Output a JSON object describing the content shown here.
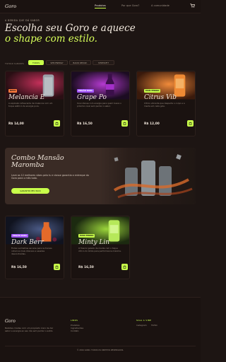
{
  "header": {
    "logo": "Goro",
    "nav": [
      "Produtos",
      "Por que Goro?",
      "A comunidade"
    ],
    "cart_icon": "cart-icon"
  },
  "hero": {
    "eyebrow": "A BEBIDA QUE DÁ SABOR",
    "title_line1": "Escolha seu Goro e aquece",
    "title_line2": "o shape com estilo."
  },
  "filters": {
    "label": "FILTRAR SABORES",
    "chips": [
      "TODOS",
      "SEM ENERGY",
      "BAIXO REDUZ.",
      "STRESSFIT"
    ],
    "active_index": 0
  },
  "products_row1": [
    {
      "tag": "NOVO",
      "title": "Melancia E",
      "desc": "A explosão refrescante de melancia com um toque elétrico de energia pura.",
      "price": "R$ 14,00"
    },
    {
      "tag": "EDIÇÃO RARA",
      "title": "Grape Po",
      "desc": "Uva intensa com energia para quem busca o próximo nível sem perder o sabor.",
      "price": "R$ 16,50"
    },
    {
      "tag": "MAIS PEDIDO",
      "title": "Citrus Vib",
      "desc": "Cítrico vibrante que desperta o corpo e a mente em cada gole.",
      "price": "R$ 12,00"
    }
  ],
  "combo": {
    "title_line1": "Combo Mansão",
    "title_line2": "Maromba",
    "desc": "Leve as 12 melhores vibes pelo tu e classe garantia a entreque do Goro para o mês todo.",
    "button": "GARANTIR MEU PACK"
  },
  "products_row2": [
    {
      "tag": "EDIÇÃO RARA",
      "title": "Dark Berr",
      "desc": "Frutas vermelhas escuras para os treinos noturnos mais intensos e sessões descontraídas.",
      "price": "R$ 16,50"
    },
    {
      "tag": "MAIS PEDIDO",
      "title": "Minty Lin",
      "desc": "O frescor gelado da menta com o toque cítrico do limão para performance máxima.",
      "price": "R$ 16,50"
    }
  ],
  "footer": {
    "logo": "Goro",
    "about": "Bebidas criadas com um propósito claro de dar sabor e energia ao seu dia sem perder o estilo.",
    "col1_title": "LINKS",
    "col1_items": [
      "Produtos",
      "Ingredientes",
      "Contato"
    ],
    "col2_title": "SIGA A VIBE",
    "col2_items": [
      "Instagram",
      "TikTok"
    ],
    "copyright": "© 2024 GORO. TODOS OS DIREITOS RESERVADOS."
  }
}
